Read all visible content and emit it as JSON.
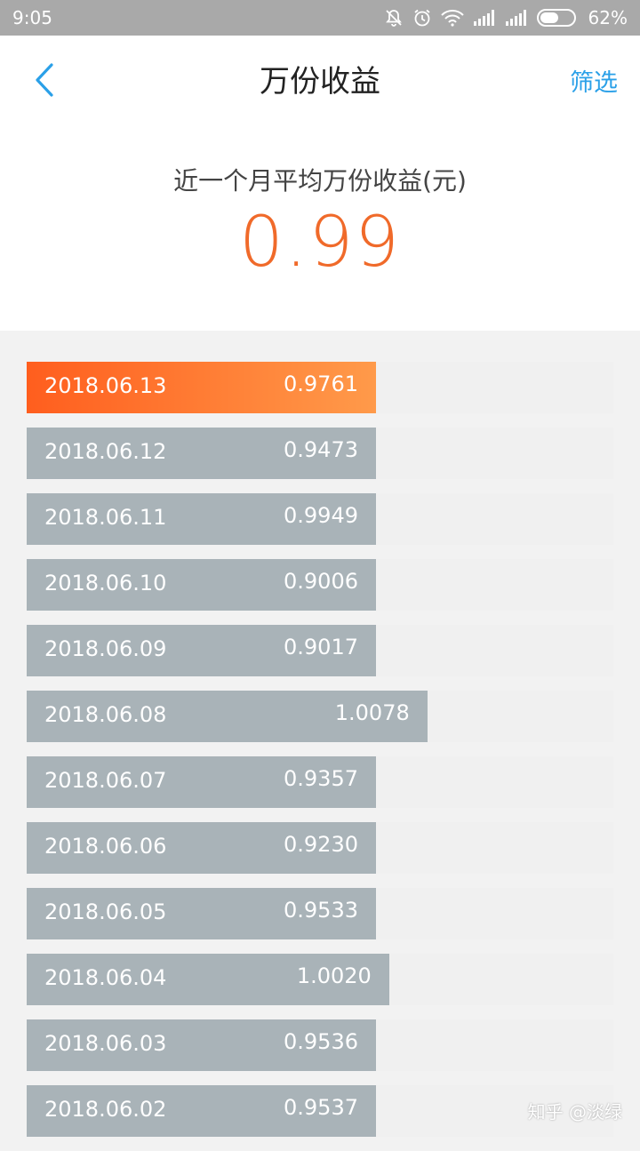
{
  "status_bar": {
    "time": "9:05",
    "battery": "62%",
    "icons": [
      "mute-bell-icon",
      "alarm-icon",
      "wifi-icon",
      "signal-icon",
      "signal-icon",
      "battery-icon"
    ]
  },
  "nav": {
    "back_icon": "chevron-left-icon",
    "title": "万份收益",
    "filter_label": "筛选"
  },
  "summary": {
    "label": "近一个月平均万份收益(元)",
    "value": "0.99"
  },
  "list": {
    "scale_max": 1.0078,
    "rows": [
      {
        "date": "2018.06.13",
        "value": "0.9761",
        "highlight": true
      },
      {
        "date": "2018.06.12",
        "value": "0.9473"
      },
      {
        "date": "2018.06.11",
        "value": "0.9949"
      },
      {
        "date": "2018.06.10",
        "value": "0.9006"
      },
      {
        "date": "2018.06.09",
        "value": "0.9017"
      },
      {
        "date": "2018.06.08",
        "value": "1.0078"
      },
      {
        "date": "2018.06.07",
        "value": "0.9357"
      },
      {
        "date": "2018.06.06",
        "value": "0.9230"
      },
      {
        "date": "2018.06.05",
        "value": "0.9533"
      },
      {
        "date": "2018.06.04",
        "value": "1.0020"
      },
      {
        "date": "2018.06.03",
        "value": "0.9536"
      },
      {
        "date": "2018.06.02",
        "value": "0.9537"
      }
    ]
  },
  "watermark": "知乎 @淡绿",
  "colors": {
    "accent_orange": "#f06a2a",
    "link_blue": "#2aa0e8",
    "bar_gray": "#a9b3b8"
  }
}
